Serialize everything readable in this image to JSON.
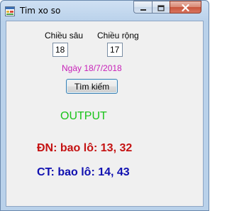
{
  "window": {
    "title": "Tim xo so",
    "icon": "app-form-icon"
  },
  "controls": {
    "minimize_icon": "minimize-icon",
    "maximize_icon": "restore-icon",
    "close_icon": "close-icon"
  },
  "form": {
    "depth_label": "Chiều sâu",
    "depth_value": "18",
    "width_label": "Chiều rộng",
    "width_value": "17",
    "date_label": "Ngày 18/7/2018",
    "search_button": "Tìm kiếm"
  },
  "output": {
    "heading": "OUTPUT",
    "result_dn": "ĐN: bao lô: 13, 32",
    "result_ct": "CT: bao lô: 14, 43"
  },
  "colors": {
    "date": "#c71fb8",
    "output": "#19c319",
    "result_dn": "#c41212",
    "result_ct": "#1010b0"
  }
}
